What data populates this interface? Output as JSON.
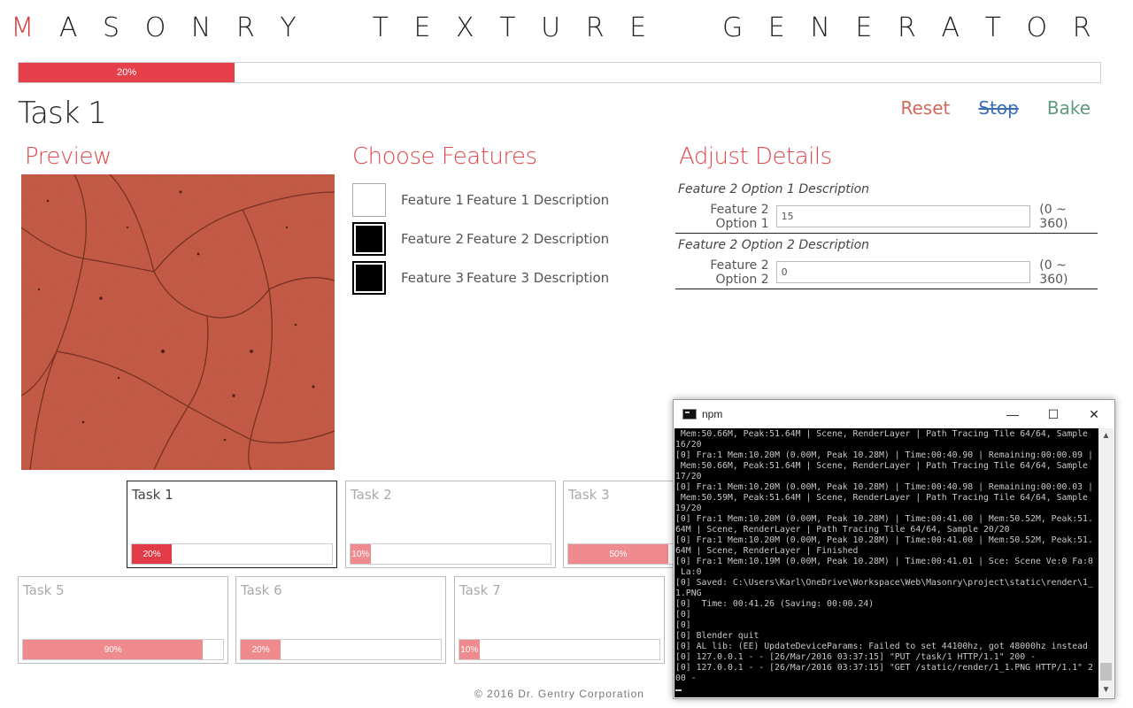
{
  "app": {
    "title_first": "M",
    "title_rest": "ASONRY TEXTURE GENERATOR",
    "progress_label": "20%",
    "progress_fraction": 0.2
  },
  "task": {
    "title": "Task 1",
    "actions": {
      "reset": "Reset",
      "stop": "Stop",
      "bake": "Bake"
    }
  },
  "sections": {
    "preview": "Preview",
    "features": "Choose Features",
    "details": "Adjust Details"
  },
  "features": [
    {
      "name": "Feature 1",
      "description": "Feature 1 Description",
      "checked": false
    },
    {
      "name": "Feature 2",
      "description": "Feature 2 Description",
      "checked": true
    },
    {
      "name": "Feature 3",
      "description": "Feature 3 Description",
      "checked": true
    }
  ],
  "details": [
    {
      "description": "Feature 2 Option 1 Description",
      "label": "Feature 2 Option 1",
      "value": "15",
      "range": "(0 ~ 360)"
    },
    {
      "description": "Feature 2 Option 2 Description",
      "label": "Feature 2 Option 2",
      "value": "0",
      "range": "(0 ~ 360)"
    }
  ],
  "tasks": [
    {
      "name": "Task 1",
      "progress_label": "20%",
      "progress": 0.2,
      "active": true
    },
    {
      "name": "Task 2",
      "progress_label": "10%",
      "progress": 0.1,
      "active": false
    },
    {
      "name": "Task 3",
      "progress_label": "50%",
      "progress": 0.5,
      "active": false
    },
    {
      "name": "Task 5",
      "progress_label": "90%",
      "progress": 0.9,
      "active": false
    },
    {
      "name": "Task 6",
      "progress_label": "20%",
      "progress": 0.2,
      "active": false
    },
    {
      "name": "Task 7",
      "progress_label": "10%",
      "progress": 0.1,
      "active": false
    }
  ],
  "footer": "© 2016 Dr. Gentry Corporation",
  "terminal": {
    "title": "npm",
    "lines": [
      " Mem:50.66M, Peak:51.64M | Scene, RenderLayer | Path Tracing Tile 64/64, Sample",
      "16/20",
      "[0] Fra:1 Mem:10.20M (0.00M, Peak 10.28M) | Time:00:40.90 | Remaining:00:00.09 |",
      " Mem:50.66M, Peak:51.64M | Scene, RenderLayer | Path Tracing Tile 64/64, Sample",
      "17/20",
      "[0] Fra:1 Mem:10.20M (0.00M, Peak 10.28M) | Time:00:40.98 | Remaining:00:00.03 |",
      " Mem:50.59M, Peak:51.64M | Scene, RenderLayer | Path Tracing Tile 64/64, Sample",
      "19/20",
      "[0] Fra:1 Mem:10.20M (0.00M, Peak 10.28M) | Time:00:41.00 | Mem:50.52M, Peak:51.",
      "64M | Scene, RenderLayer | Path Tracing Tile 64/64, Sample 20/20",
      "[0] Fra:1 Mem:10.20M (0.00M, Peak 10.28M) | Time:00:41.00 | Mem:50.52M, Peak:51.",
      "64M | Scene, RenderLayer | Finished",
      "[0] Fra:1 Mem:10.19M (0.00M, Peak 10.28M) | Time:00:41.01 | Sce: Scene Ve:0 Fa:0",
      " La:0",
      "[0] Saved: C:\\Users\\Karl\\OneDrive\\Workspace\\Web\\Masonry\\project\\static\\render\\1_",
      "1.PNG",
      "[0]  Time: 00:41.26 (Saving: 00:00.24)",
      "[0]",
      "[0]",
      "[0] Blender quit",
      "[0] AL lib: (EE) UpdateDeviceParams: Failed to set 44100hz, got 48000hz instead",
      "[0] 127.0.0.1 - - [26/Mar/2016 03:37:15] \"PUT /task/1 HTTP/1.1\" 200 -",
      "[0] 127.0.0.1 - - [26/Mar/2016 03:37:15] \"GET /static/render/1_1.PNG HTTP/1.1\" 2",
      "00 -"
    ]
  },
  "colors": {
    "accent": "#e0474b",
    "progress_active": "#e33a48",
    "progress_inactive": "#ef8a8e",
    "reset": "#d0685a",
    "stop": "#3b6fb6",
    "bake": "#5e9a7e",
    "texture": "#c45a45"
  }
}
